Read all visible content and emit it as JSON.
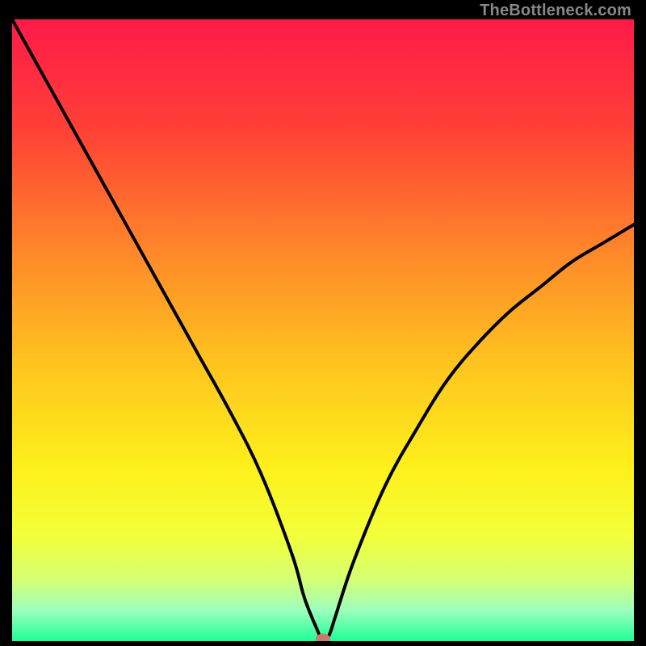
{
  "attribution": "TheBottleneck.com",
  "chart_data": {
    "type": "line",
    "title": "",
    "xlabel": "",
    "ylabel": "",
    "xlim": [
      0,
      100
    ],
    "ylim": [
      0,
      100
    ],
    "x": [
      0,
      5,
      10,
      15,
      20,
      25,
      30,
      35,
      40,
      45,
      47,
      49,
      50,
      51,
      52,
      55,
      60,
      65,
      70,
      75,
      80,
      85,
      90,
      95,
      100
    ],
    "y": [
      100,
      91,
      82,
      73,
      64,
      55,
      46,
      37,
      27,
      14,
      7,
      2,
      0,
      1,
      4,
      13,
      25,
      34,
      42,
      48,
      53,
      57,
      61,
      64,
      67
    ],
    "marker_point": {
      "x": 50,
      "y": 0
    },
    "background": {
      "type": "vertical-gradient",
      "stops": [
        {
          "offset": 0.0,
          "color": "#ff1a49"
        },
        {
          "offset": 0.18,
          "color": "#ff4136"
        },
        {
          "offset": 0.38,
          "color": "#ff8a2a"
        },
        {
          "offset": 0.55,
          "color": "#ffc31f"
        },
        {
          "offset": 0.72,
          "color": "#fef01b"
        },
        {
          "offset": 0.83,
          "color": "#f3ff39"
        },
        {
          "offset": 0.9,
          "color": "#d6ff73"
        },
        {
          "offset": 0.95,
          "color": "#9effbe"
        },
        {
          "offset": 1.0,
          "color": "#1dff96"
        }
      ]
    }
  }
}
